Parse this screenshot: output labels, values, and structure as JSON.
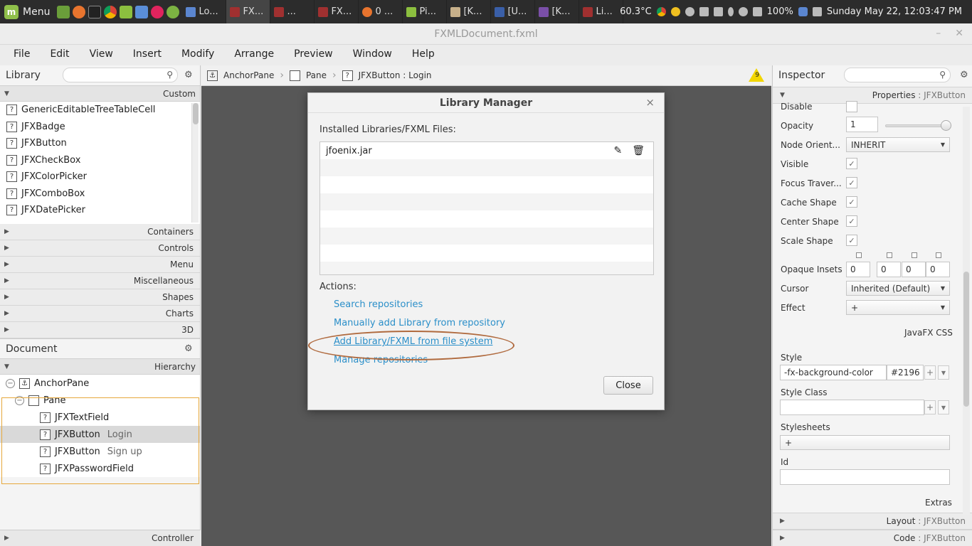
{
  "taskbar": {
    "menu_label": "Menu",
    "windows": [
      "Lo...",
      "FX...",
      "...",
      "FX...",
      "0 ...",
      "Pi...",
      "[K...",
      "[U...",
      "[K...",
      "Li..."
    ],
    "temperature": "60.3°C",
    "battery": "100%",
    "datetime": "Sunday May 22, 12:03:47 PM"
  },
  "window": {
    "title": "FXMLDocument.fxml",
    "minimize": "–",
    "close": "✕"
  },
  "menubar": [
    "File",
    "Edit",
    "View",
    "Insert",
    "Modify",
    "Arrange",
    "Preview",
    "Window",
    "Help"
  ],
  "library": {
    "title": "Library",
    "custom_label": "Custom",
    "items": [
      "GenericEditableTreeTableCell",
      "JFXBadge",
      "JFXButton",
      "JFXCheckBox",
      "JFXColorPicker",
      "JFXComboBox",
      "JFXDatePicker"
    ],
    "categories": [
      "Containers",
      "Controls",
      "Menu",
      "Miscellaneous",
      "Shapes",
      "Charts",
      "3D"
    ]
  },
  "document": {
    "title": "Document",
    "hierarchy_label": "Hierarchy",
    "tree": [
      {
        "label": "AnchorPane",
        "sub": ""
      },
      {
        "label": "Pane",
        "sub": ""
      },
      {
        "label": "JFXTextField",
        "sub": ""
      },
      {
        "label": "JFXButton",
        "sub": "Login"
      },
      {
        "label": "JFXButton",
        "sub": "Sign up"
      },
      {
        "label": "JFXPasswordField",
        "sub": ""
      }
    ],
    "controller_label": "Controller"
  },
  "breadcrumbs": [
    "AnchorPane",
    "Pane",
    "JFXButton : Login"
  ],
  "warning_count": "9",
  "dialog": {
    "title": "Library Manager",
    "installed_label": "Installed Libraries/FXML Files:",
    "libraries": [
      "jfoenix.jar"
    ],
    "actions_label": "Actions:",
    "actions": [
      "Search repositories",
      "Manually add Library from repository",
      "Add Library/FXML from file system",
      "Manage repositories"
    ],
    "close_label": "Close"
  },
  "inspector": {
    "title": "Inspector",
    "properties_label": "Properties",
    "properties_target": ": JFXButton",
    "disable_label": "Disable",
    "opacity_label": "Opacity",
    "opacity_value": "1",
    "node_orient_label": "Node Orient...",
    "node_orient_value": "INHERIT",
    "visible_label": "Visible",
    "focus_label": "Focus Traver...",
    "cache_label": "Cache Shape",
    "center_label": "Center Shape",
    "scale_label": "Scale Shape",
    "opaque_label": "Opaque Insets",
    "opaque_values": [
      "0",
      "0",
      "0",
      "0"
    ],
    "cursor_label": "Cursor",
    "cursor_value": "Inherited (Default)",
    "effect_label": "Effect",
    "effect_value": "+",
    "javafx_css": "JavaFX CSS",
    "style_label": "Style",
    "style_prop": "-fx-background-color",
    "style_value": "#2196",
    "style_class_label": "Style Class",
    "stylesheets_label": "Stylesheets",
    "stylesheets_add": "+",
    "id_label": "Id",
    "extras_label": "Extras",
    "layout_label": "Layout",
    "layout_target": ": JFXButton",
    "code_label": "Code",
    "code_target": ": JFXButton"
  }
}
